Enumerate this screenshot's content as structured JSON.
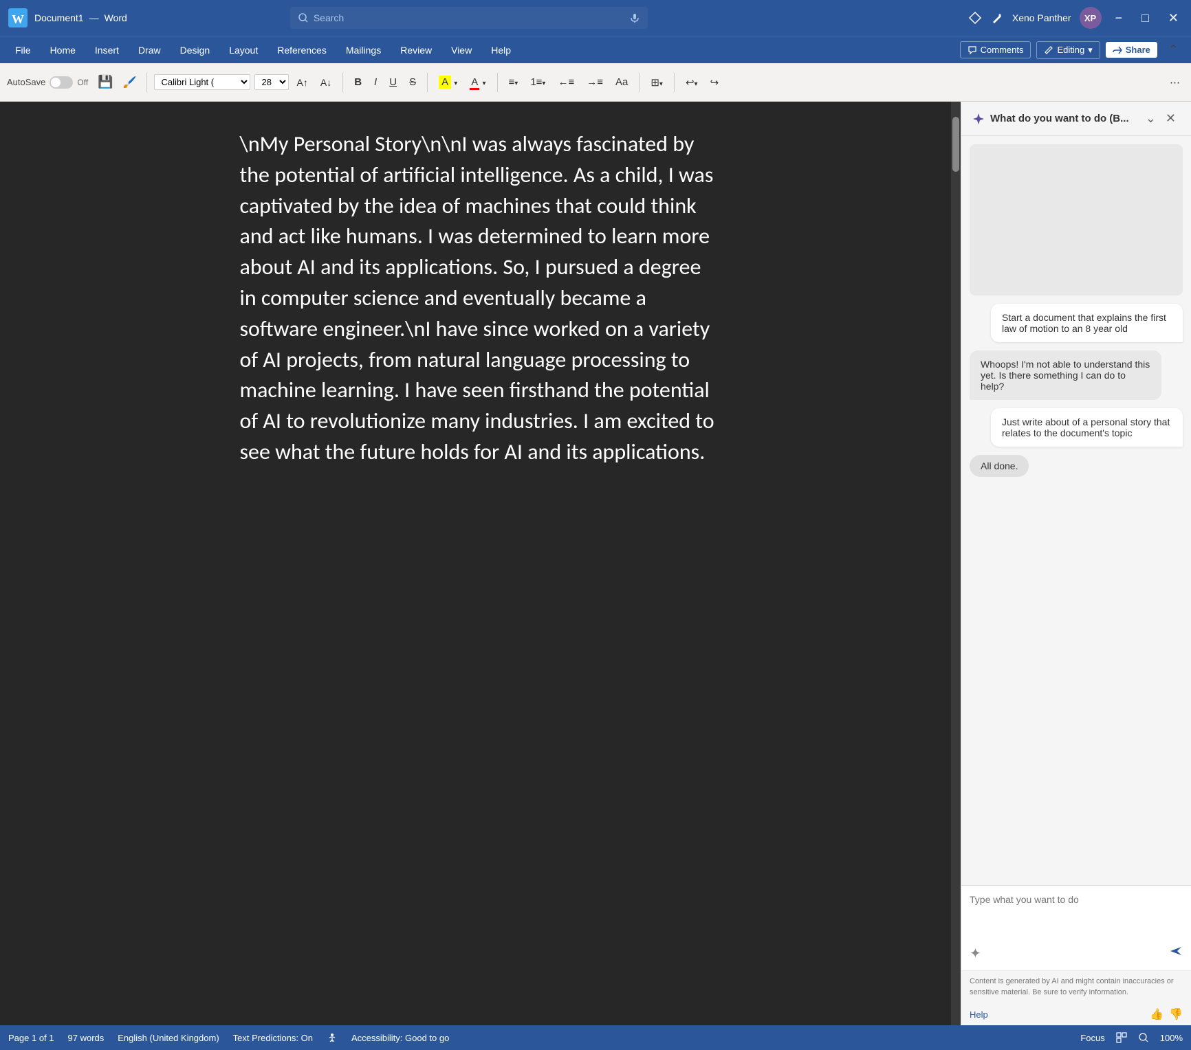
{
  "title_bar": {
    "app_name": "Word",
    "doc_name": "Document1",
    "separator": "—",
    "search_placeholder": "Search",
    "user_name": "Xeno Panther",
    "avatar_initials": "XP",
    "minimize_label": "−",
    "maximize_label": "□",
    "close_label": "✕"
  },
  "menu": {
    "items": [
      "File",
      "Home",
      "Insert",
      "Draw",
      "Design",
      "Layout",
      "References",
      "Mailings",
      "Review",
      "View",
      "Help"
    ]
  },
  "toolbar_right": {
    "comments_label": "Comments",
    "editing_label": "Editing",
    "share_label": "Share"
  },
  "ribbon": {
    "autosave_label": "AutoSave",
    "autosave_state": "Off",
    "font_name": "Calibri Light (",
    "font_size": "28",
    "bold_label": "B",
    "italic_label": "I",
    "underline_label": "U"
  },
  "document": {
    "content": "\\nMy Personal Story\\n\\nI was always fascinated by the potential of artificial intelligence. As a child, I was captivated by the idea of machines that could think and act like humans. I was determined to learn more about AI and its applications. So, I pursued a degree in computer science and eventually became a software engineer.\\nI have since worked on a variety of AI projects, from natural language processing to machine learning. I have seen firsthand the potential of AI to revolutionize many industries. I am excited to see what the future holds for AI and its applications."
  },
  "ai_panel": {
    "title": "What do you want to do (B...",
    "chat": {
      "message1": "Start a document that explains the first law of motion to an 8 year old",
      "message2": "Whoops! I'm not able to understand this yet. Is there something I can do to help?",
      "message3": "Just write about of a personal story that relates to the document's topic",
      "message4": "All done."
    },
    "input_placeholder": "Type what you want to do",
    "disclaimer": "Content is generated by AI and might contain inaccuracies or sensitive material. Be sure to verify information.",
    "help_link": "Help"
  },
  "status_bar": {
    "page_info": "Page 1 of 1",
    "word_count": "97 words",
    "language": "English (United Kingdom)",
    "text_predictions": "Text Predictions: On",
    "accessibility": "Accessibility: Good to go",
    "focus_label": "Focus",
    "zoom_level": "100%"
  }
}
